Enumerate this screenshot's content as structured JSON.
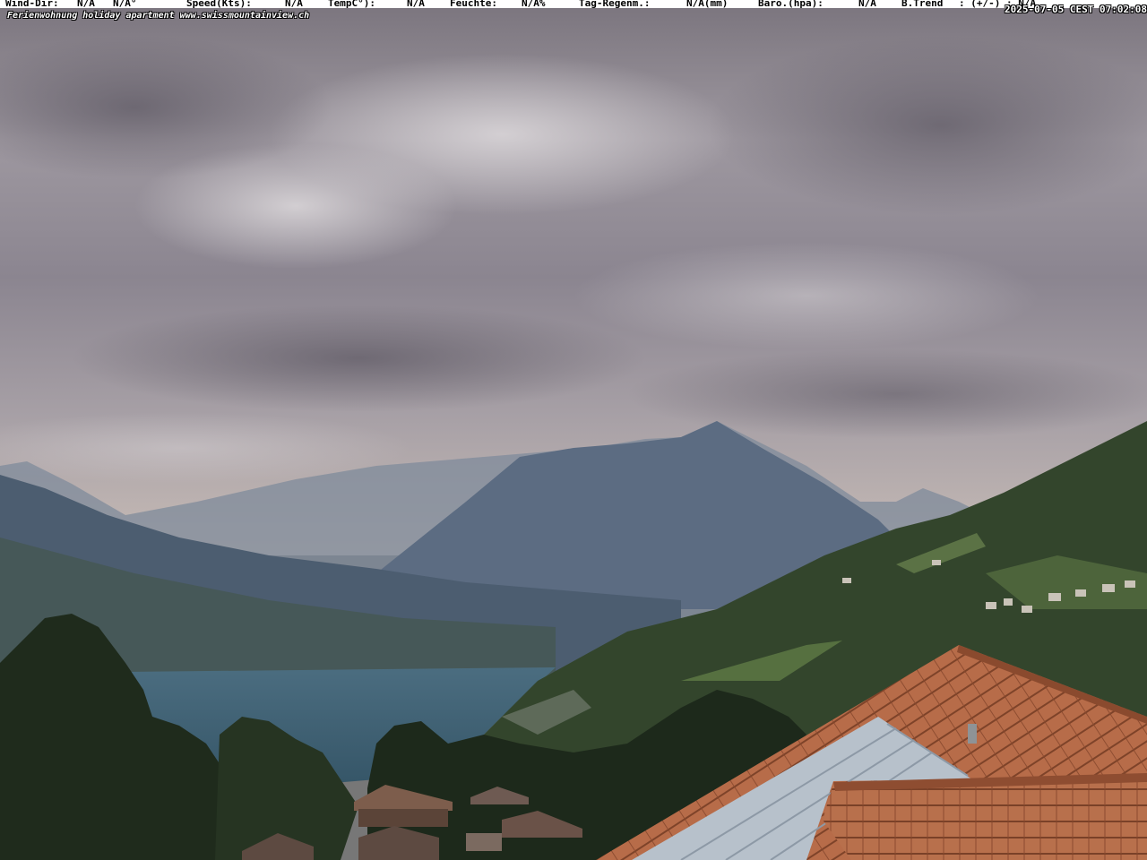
{
  "overlay": {
    "wind_dir_label": "Wind-Dir:",
    "wind_dir_value": "N/A",
    "wind_deg_value": "N/A°",
    "speed_label": "Speed(Kts):",
    "speed_value": "N/A",
    "temp_label": "TempC°):",
    "temp_value": "N/A",
    "humidity_label": "Feuchte:",
    "humidity_value": "N/A%",
    "rain_label": "Tag-Regenm.:",
    "rain_value": "N/A(mm)",
    "baro_label": "Baro.(hpa):",
    "baro_value": "N/A",
    "trend_label": "B.Trend",
    "trend_value": ": (+/-) : N/A",
    "site_caption": "Ferienwohnung holiday apartment www.swissmountainview.ch",
    "timestamp": "2025-07-05 CEST 07:02:08"
  },
  "colors": {
    "sky_top": "#6f6a73",
    "sky_mid": "#b7b1b8",
    "haze": "#c9bfb9",
    "lake": "#3f6478",
    "roof": "#b46a48",
    "solar": "#b9c3cd"
  }
}
